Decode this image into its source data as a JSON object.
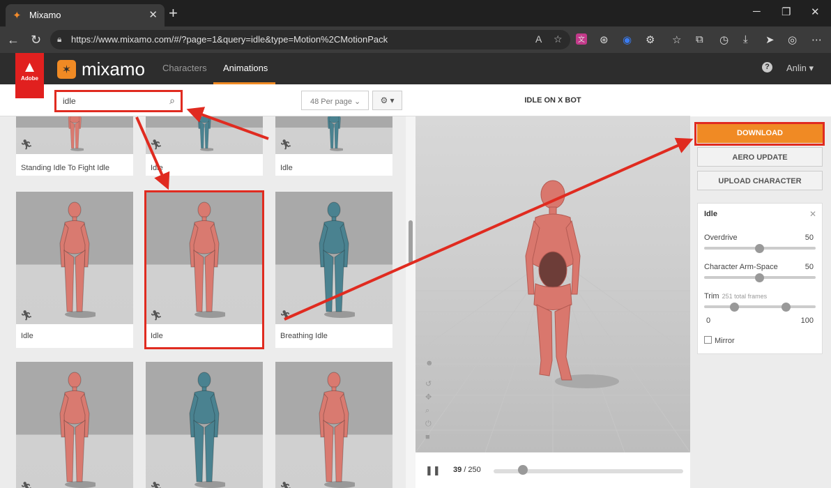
{
  "browser": {
    "tab_title": "Mixamo",
    "url": "https://www.mixamo.com/#/?page=1&query=idle&type=Motion%2CMotionPack"
  },
  "header": {
    "adobe_label": "Adobe",
    "brand": "mixamo",
    "nav": [
      "Characters",
      "Animations"
    ],
    "user": "Anlin"
  },
  "search": {
    "value": "idle",
    "per_page": "48 Per page"
  },
  "cards": [
    {
      "label": "Standing Idle To Fight Idle",
      "color": "#d97a70"
    },
    {
      "label": "Idle",
      "color": "#4a8290"
    },
    {
      "label": "Idle",
      "color": "#4a8290"
    },
    {
      "label": "Idle",
      "color": "#d97a70"
    },
    {
      "label": "Idle",
      "color": "#d97a70"
    },
    {
      "label": "Breathing Idle",
      "color": "#4a8290"
    },
    {
      "label": "",
      "color": "#d97a70"
    },
    {
      "label": "",
      "color": "#4a8290"
    },
    {
      "label": "",
      "color": "#d97a70"
    }
  ],
  "viewer": {
    "title": "IDLE ON X BOT",
    "frame_current": "39",
    "frame_total": "/ 250",
    "frame_fraction": 0.156
  },
  "actions": {
    "download": "DOWNLOAD",
    "aero_update": "AERO UPDATE",
    "upload_character": "UPLOAD CHARACTER"
  },
  "settings": {
    "title": "Idle",
    "overdrive_label": "Overdrive",
    "overdrive_value": "50",
    "armspace_label": "Character Arm-Space",
    "armspace_value": "50",
    "trim_label": "Trim",
    "trim_note": "251 total frames",
    "trim_min": "0",
    "trim_max": "100",
    "mirror_label": "Mirror"
  },
  "colors": {
    "accent": "#f08a24",
    "annotation": "#e02b20"
  }
}
